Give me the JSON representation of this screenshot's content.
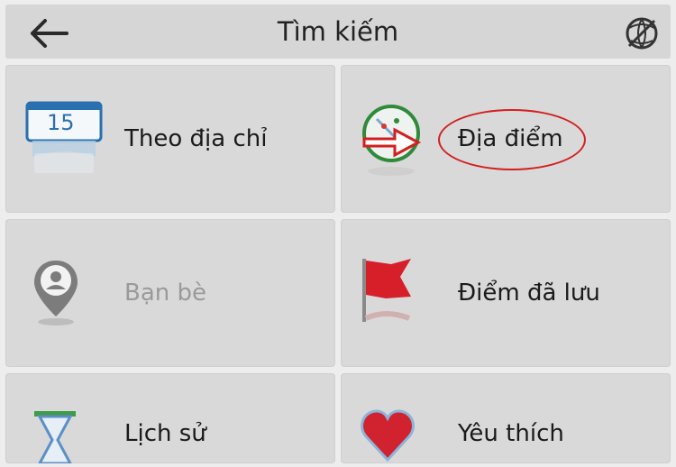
{
  "header": {
    "title": "Tìm kiếm",
    "back_icon": "arrow-left-icon",
    "map_icon": "globe-off-icon"
  },
  "tiles": [
    {
      "label": "Theo địa chỉ",
      "icon": "calendar-address-icon",
      "badge": "15",
      "enabled": true
    },
    {
      "label": "Địa điểm",
      "icon": "poi-compass-icon",
      "enabled": true,
      "highlighted": true
    },
    {
      "label": "Bạn bè",
      "icon": "friend-pin-icon",
      "enabled": false
    },
    {
      "label": "Điểm đã lưu",
      "icon": "red-flag-icon",
      "enabled": true
    },
    {
      "label": "Lịch sử",
      "icon": "hourglass-icon",
      "enabled": true
    },
    {
      "label": "Yêu thích",
      "icon": "heart-icon",
      "enabled": true
    }
  ],
  "colors": {
    "background": "#ededed",
    "tile": "#d9d9d9",
    "header": "#d6d6d6",
    "highlight": "#d21f1f",
    "disabled_text": "#9a9a9a"
  }
}
